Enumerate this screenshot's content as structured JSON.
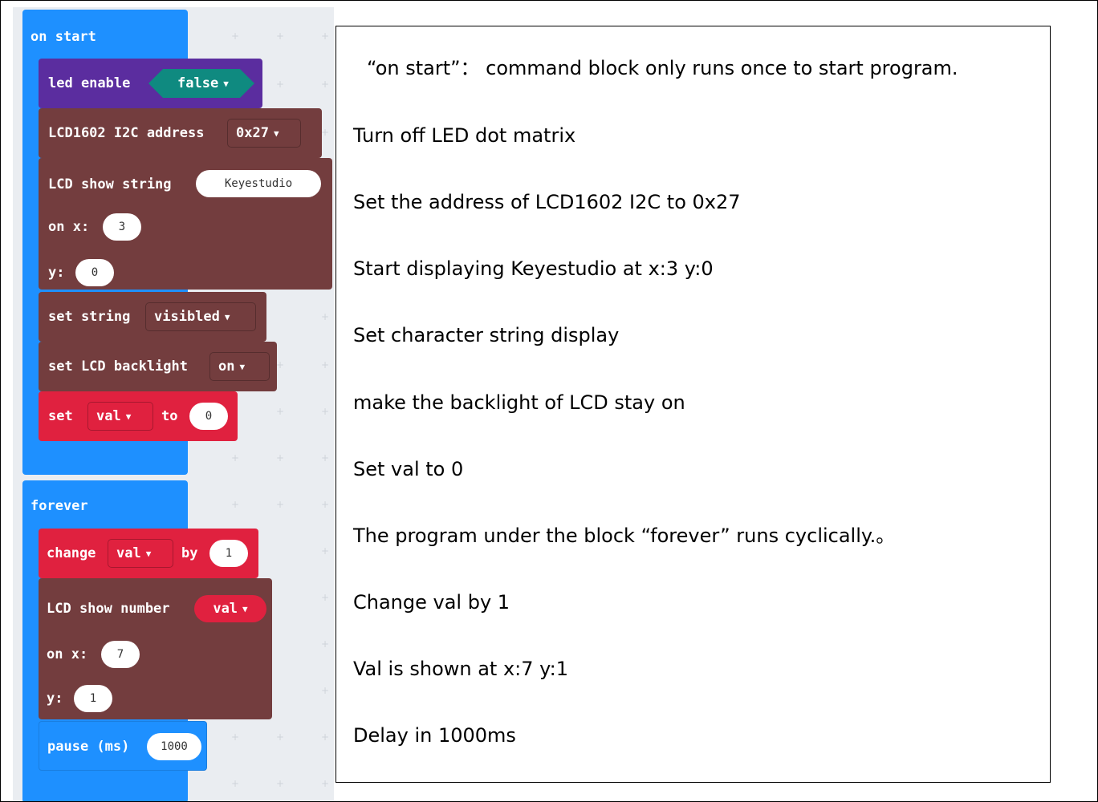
{
  "blocks": {
    "on_start": {
      "hat": "on start",
      "led_enable": "led enable",
      "led_value": "false",
      "lcd_address": "LCD1602 I2C address",
      "address_value": "0x27",
      "show_string": "LCD show string",
      "string_value": "Keyestudio",
      "on_x": "on x:",
      "x_value": "3",
      "y": "y:",
      "y_value": "0",
      "set_string": "set string",
      "visibility_value": "visibled",
      "set_backlight": "set LCD backlight",
      "backlight_value": "on",
      "set": "set",
      "var": "val",
      "to": "to",
      "to_value": "0"
    },
    "forever": {
      "hat": "forever",
      "change": "change",
      "var": "val",
      "by": "by",
      "by_value": "1",
      "show_number": "LCD show number",
      "number_var": "val",
      "on_x": "on x:",
      "x_value": "7",
      "y": "y:",
      "y_value": "1",
      "pause": "pause (ms)",
      "pause_value": "1000"
    }
  },
  "descriptions": [
    "“on start”： command block only runs once to start program.",
    "Turn off LED dot matrix",
    "Set the address of LCD1602 I2C to 0x27",
    "Start displaying Keyestudio at x:3 y:0",
    "Set character string display",
    "make the backlight of LCD stay on",
    "Set val to 0",
    "The program under the block “forever” runs cyclically.。",
    "Change val by 1",
    "Val is shown at x:7 y:1",
    "Delay in 1000ms"
  ],
  "icons": {
    "dropdown": "triangle-down-icon",
    "grid": "plus-icon"
  },
  "colors": {
    "basic": "#1e90ff",
    "led": "#5b2d9f",
    "lcd": "#733d3e",
    "variables": "#e0213f",
    "logic": "#0f8a80",
    "workspace": "#eaedf1"
  }
}
